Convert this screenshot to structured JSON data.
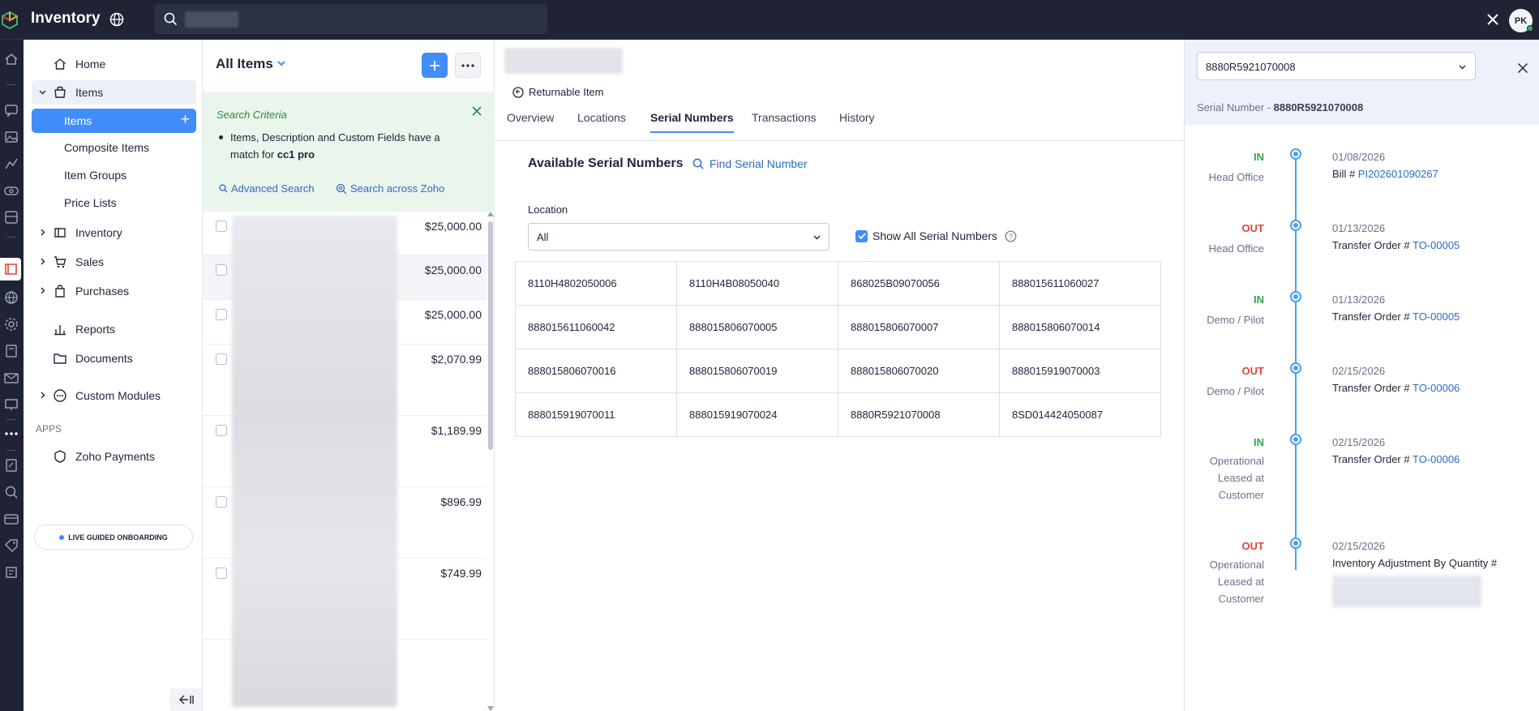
{
  "app": {
    "title": "Inventory",
    "user_initials": "PK"
  },
  "sidebar": {
    "items": [
      {
        "label": "Home",
        "icon": "home-icon"
      },
      {
        "label": "Items",
        "icon": "basket-icon"
      },
      {
        "label": "Items"
      },
      {
        "label": "Composite Items"
      },
      {
        "label": "Item Groups"
      },
      {
        "label": "Price Lists"
      },
      {
        "label": "Inventory",
        "icon": "inventory-icon"
      },
      {
        "label": "Sales",
        "icon": "cart-icon"
      },
      {
        "label": "Purchases",
        "icon": "bag-icon"
      },
      {
        "label": "Reports",
        "icon": "bar-chart-icon"
      },
      {
        "label": "Documents",
        "icon": "folder-icon"
      },
      {
        "label": "Custom Modules",
        "icon": "modules-icon"
      }
    ],
    "apps_header": "APPS",
    "apps": [
      {
        "label": "Zoho Payments",
        "icon": "payments-icon"
      }
    ],
    "onboarding": "LIVE GUIDED ONBOARDING"
  },
  "list": {
    "title": "All Items",
    "criteria": {
      "title": "Search Criteria",
      "text_prefix": "Items, Description and Custom Fields have a match for",
      "term": "cc1 pro",
      "advanced_search": "Advanced Search",
      "search_across": "Search across Zoho"
    },
    "prices": [
      "$25,000.00",
      "$25,000.00",
      "$25,000.00",
      "$2,070.99",
      "$1,189.99",
      "$896.99",
      "$749.99"
    ]
  },
  "detail": {
    "returnable": "Returnable Item",
    "tabs": [
      "Overview",
      "Locations",
      "Serial Numbers",
      "Transactions",
      "History"
    ],
    "active_tab": "Serial Numbers",
    "heading": "Available Serial Numbers",
    "find_link": "Find Serial Number",
    "location_label": "Location",
    "location_value": "All",
    "show_all_label": "Show All Serial Numbers",
    "show_all_checked": true,
    "serials": [
      [
        "8110H4802050006",
        "8110H4B08050040",
        "868025B09070056",
        "888015611060027"
      ],
      [
        "888015611060042",
        "888015806070005",
        "888015806070007",
        "888015806070014"
      ],
      [
        "888015806070016",
        "888015806070019",
        "888015806070020",
        "888015919070003"
      ],
      [
        "888015919070011",
        "888015919070024",
        "8880R5921070008",
        "8SD014424050087"
      ]
    ]
  },
  "panel": {
    "selected_serial": "8880R5921070008",
    "serial_label": "Serial Number - ",
    "serial_value": "8880R5921070008",
    "timeline": [
      {
        "dir": "IN",
        "loc": "Head Office",
        "date": "01/08/2026",
        "doc_prefix": "Bill # ",
        "doc_link": "PI202601090267"
      },
      {
        "dir": "OUT",
        "loc": "Head Office",
        "date": "01/13/2026",
        "doc_prefix": "Transfer Order # ",
        "doc_link": "TO-00005"
      },
      {
        "dir": "IN",
        "loc": "Demo / Pilot",
        "date": "01/13/2026",
        "doc_prefix": "Transfer Order # ",
        "doc_link": "TO-00005"
      },
      {
        "dir": "OUT",
        "loc": "Demo / Pilot",
        "date": "02/15/2026",
        "doc_prefix": "Transfer Order # ",
        "doc_link": "TO-00006"
      },
      {
        "dir": "IN",
        "loc": "Operational Leased at Customer",
        "date": "02/15/2026",
        "doc_prefix": "Transfer Order # ",
        "doc_link": "TO-00006"
      },
      {
        "dir": "OUT",
        "loc": "Operational Leased at Customer",
        "date": "02/15/2026",
        "doc_prefix": "Inventory Adjustment By Quantity # ",
        "doc_link": ""
      }
    ]
  },
  "colors": {
    "accent": "#408dfb",
    "in": "#36a34f",
    "out": "#e3443b",
    "topbar": "#1f2333"
  }
}
